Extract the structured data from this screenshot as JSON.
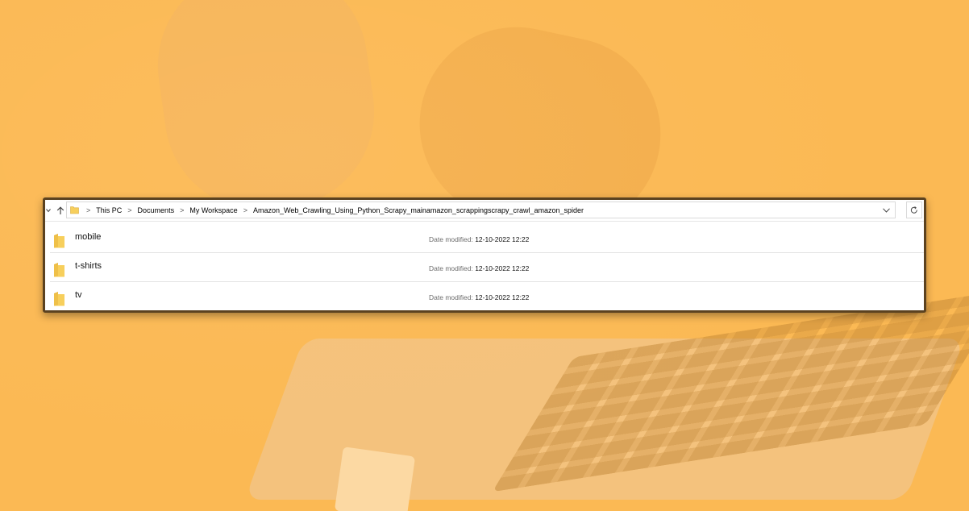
{
  "breadcrumb": {
    "items": [
      "This PC",
      "Documents",
      "My Workspace",
      "Amazon_Web_Crawling_Using_Python_Scrapy_mainamazon_scrappingscrapy_crawl_amazon_spider"
    ],
    "separator": ">"
  },
  "files": [
    {
      "name": "mobile",
      "date_label": "Date modified:",
      "date": "12-10-2022 12:22"
    },
    {
      "name": "t-shirts",
      "date_label": "Date modified:",
      "date": "12-10-2022 12:22"
    },
    {
      "name": "tv",
      "date_label": "Date modified:",
      "date": "12-10-2022 12:22"
    }
  ],
  "icons": {
    "back": "chevron-down-icon",
    "up": "up-arrow-icon",
    "folder": "folder-icon",
    "dropdown": "chevron-down-icon",
    "refresh": "refresh-icon"
  },
  "colors": {
    "background": "#fbb954",
    "window_border": "#5b4220",
    "folder": "#f7cf5c"
  }
}
